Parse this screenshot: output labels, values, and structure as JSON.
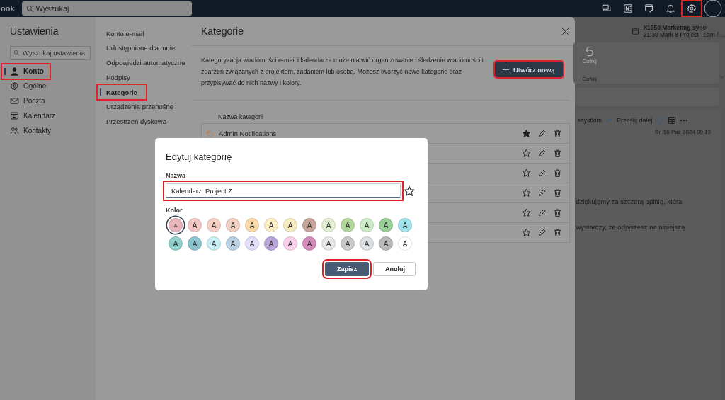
{
  "top_bar": {
    "app_name": "ook",
    "search": {
      "placeholder": "Wyszukaj"
    },
    "icons": [
      {
        "kind": "chat",
        "highlighted": false
      },
      {
        "kind": "notes",
        "highlighted": false
      },
      {
        "kind": "tasks",
        "highlighted": false
      },
      {
        "kind": "bell",
        "highlighted": false
      },
      {
        "kind": "gear",
        "highlighted": true
      },
      {
        "kind": "avatar",
        "highlighted": false
      }
    ]
  },
  "settings": {
    "title": "Ustawienia",
    "search": {
      "placeholder": "Wyszukaj ustawienia"
    },
    "sections": [
      {
        "label": "Konto",
        "kind": "person",
        "selected": true,
        "highlighted": true
      },
      {
        "label": "Ogólne",
        "kind": "gear",
        "selected": false,
        "highlighted": false
      },
      {
        "label": "Poczta",
        "kind": "mail",
        "selected": false,
        "highlighted": false
      },
      {
        "label": "Kalendarz",
        "kind": "calendar",
        "selected": false,
        "highlighted": false
      },
      {
        "label": "Kontakty",
        "kind": "people",
        "selected": false,
        "highlighted": false
      }
    ],
    "subsections": [
      {
        "label": "Konto e-mail",
        "selected": false,
        "highlighted": false
      },
      {
        "label": "Udostępnione dla mnie",
        "selected": false,
        "highlighted": false
      },
      {
        "label": "Odpowiedzi automatyczne",
        "selected": false,
        "highlighted": false
      },
      {
        "label": "Podpisy",
        "selected": false,
        "highlighted": false
      },
      {
        "label": "Kategorie",
        "selected": true,
        "highlighted": true
      },
      {
        "label": "Urządzenia przenośne",
        "selected": false,
        "highlighted": false
      },
      {
        "label": "Przestrzeń dyskowa",
        "selected": false,
        "highlighted": false
      }
    ],
    "page": {
      "title": "Kategorie",
      "description": "Kategoryzacja wiadomości e-mail i kalendarza może ułatwić organizowanie i śledzenie wiadomości i zdarzeń związanych z projektem, zadaniem lub osobą. Możesz tworzyć nowe kategorie oraz przypisywać do nich nazwy i kolory.",
      "create_button": {
        "label": "Utwórz nową",
        "highlighted": true
      },
      "column_header": "Nazwa kategorii",
      "categories": [
        {
          "name": "Admin Notifications",
          "favorite": true
        },
        {
          "favorite": false
        },
        {
          "favorite": false
        },
        {
          "favorite": false
        },
        {
          "favorite": false
        },
        {
          "favorite": false
        }
      ]
    }
  },
  "mail_pane": {
    "reminder": {
      "title": "X1050 Marketing sync",
      "detail": "21:30 Mark 8 Project Team / ..."
    },
    "ribbon": {
      "undo_label": "Cofnij",
      "group_label": "Cofnij"
    },
    "toolbar": {
      "reply_all": "szystkim",
      "forward": "Prześlij dalej"
    },
    "date": "Śr, 16 Paź 2024 00:13",
    "body_lines": [
      "dziękujęmy za szczerą opinię, która",
      "wystarczy, że odpiszesz na niniejszą"
    ]
  },
  "dialog": {
    "title": "Edytuj kategorię",
    "name_label": "Nazwa",
    "name_value": "Kalendarz: Project Z",
    "name_highlighted": true,
    "favorite": false,
    "color_label": "Kolor",
    "colors": [
      {
        "label": "A",
        "color": "#e8b4bc",
        "selected": true
      },
      {
        "label": "A",
        "color": "#f4c6c6",
        "selected": false
      },
      {
        "label": "A",
        "color": "#f6cfc4",
        "selected": false
      },
      {
        "label": "A",
        "color": "#f0d0c0",
        "selected": false
      },
      {
        "label": "A",
        "color": "#fbd8a8",
        "selected": false
      },
      {
        "label": "A",
        "color": "#fdeec6",
        "selected": false
      },
      {
        "label": "A",
        "color": "#f7ecc0",
        "selected": false
      },
      {
        "label": "A",
        "color": "#c6a49a",
        "selected": false
      },
      {
        "label": "A",
        "color": "#e0efd0",
        "selected": false
      },
      {
        "label": "A",
        "color": "#b4d89c",
        "selected": false
      },
      {
        "label": "A",
        "color": "#cdebc8",
        "selected": false
      },
      {
        "label": "A",
        "color": "#98cf94",
        "selected": false
      },
      {
        "label": "A",
        "color": "#a0e2ea",
        "selected": false
      },
      {
        "label": "A",
        "color": "#8fd0cc",
        "selected": false
      },
      {
        "label": "A",
        "color": "#8cc4d0",
        "selected": false
      },
      {
        "label": "A",
        "color": "#c8eef6",
        "selected": false
      },
      {
        "label": "A",
        "color": "#b8d0e2",
        "selected": false
      },
      {
        "label": "A",
        "color": "#e4defa",
        "selected": false
      },
      {
        "label": "A",
        "color": "#b8a4d8",
        "selected": false
      },
      {
        "label": "A",
        "color": "#f8d0ea",
        "selected": false
      },
      {
        "label": "A",
        "color": "#d48cbc",
        "selected": false
      },
      {
        "label": "A",
        "color": "#e8e8e8",
        "selected": false
      },
      {
        "label": "A",
        "color": "#c8c8c8",
        "selected": false
      },
      {
        "label": "A",
        "color": "#dadfe2",
        "selected": false
      },
      {
        "label": "A",
        "color": "#b8b8b8",
        "selected": false
      },
      {
        "label": "A",
        "color": "#ffffff",
        "selected": false
      }
    ],
    "buttons": [
      {
        "label": "Zapisz",
        "kind": "primary",
        "highlighted": true
      },
      {
        "label": "Anuluj",
        "kind": "secondary",
        "highlighted": false
      }
    ]
  }
}
